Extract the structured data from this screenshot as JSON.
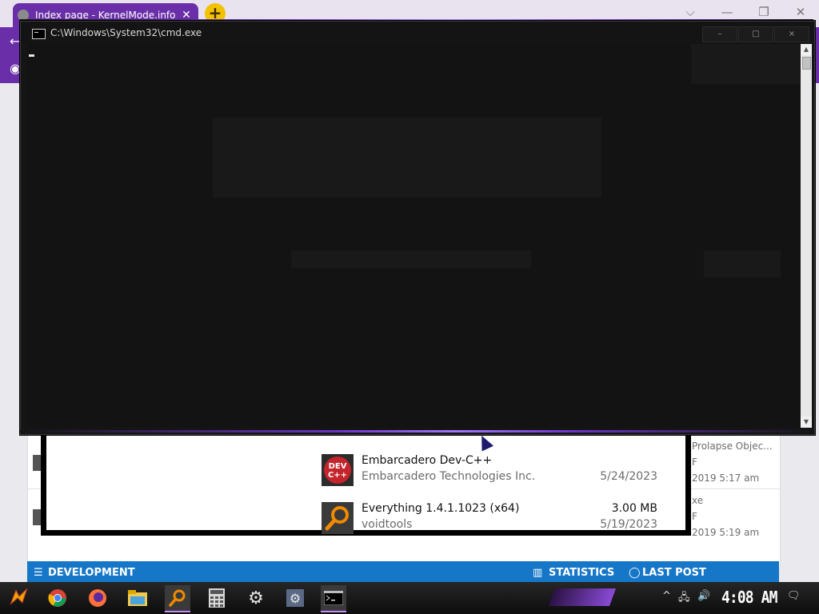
{
  "browser": {
    "tab_title": "Index page - KernelMode.info",
    "tab_close": "✕",
    "new_tab": "+",
    "controls": {
      "dropdown": "⌵",
      "minimize": "—",
      "restore": "❐",
      "close": "✕"
    }
  },
  "cmd": {
    "title": "C:\\Windows\\System32\\cmd.exe",
    "controls": {
      "minimize": "–",
      "maximize": "□",
      "close": "×"
    },
    "scroll_up": "▲",
    "scroll_down": "▼"
  },
  "apps": [
    {
      "name": "Embarcadero Dev-C++",
      "publisher": "Embarcadero Technologies Inc.",
      "size": "",
      "date": "5/24/2023",
      "icon": "devcpp-icon"
    },
    {
      "name": "Everything 1.4.1.1023 (x64)",
      "publisher": "voidtools",
      "size": "3.00 MB",
      "date": "5/19/2023",
      "icon": "everything-search-icon"
    }
  ],
  "forum": {
    "row1": {
      "text": "Prolapse Objec...",
      "meta": "F",
      "date": "2019 5:17 am"
    },
    "row2": {
      "text": "xe",
      "meta": "F",
      "date": "2019 5:19 am"
    },
    "section_title": "DEVELOPMENT",
    "stats_label": "STATISTICS",
    "last_post_label": "LAST POST"
  },
  "taskbar": {
    "clock": "4:08 AM",
    "tray_chevron": "^"
  },
  "colors": {
    "browser_accent": "#6a2fa8",
    "cmd_background": "#131313",
    "section_blue": "#1677c9",
    "glow": "#a574ff"
  }
}
